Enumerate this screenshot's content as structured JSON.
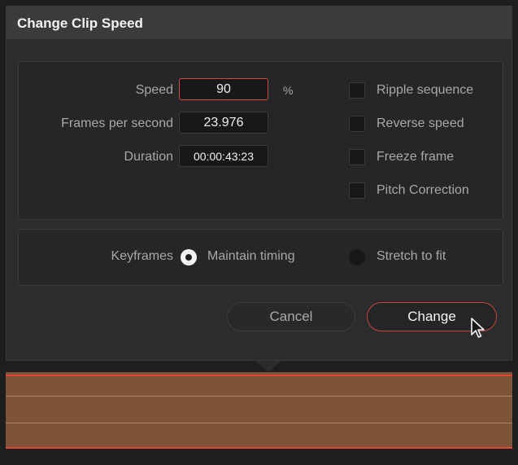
{
  "dialog": {
    "title": "Change Clip Speed",
    "speed": {
      "label": "Speed",
      "value": "90",
      "unit": "%"
    },
    "fps": {
      "label": "Frames per second",
      "value": "23.976"
    },
    "duration": {
      "label": "Duration",
      "value": "00:00:43:23"
    },
    "options": [
      {
        "label": "Ripple sequence",
        "checked": false
      },
      {
        "label": "Reverse speed",
        "checked": false
      },
      {
        "label": "Freeze frame",
        "checked": false
      },
      {
        "label": "Pitch Correction",
        "checked": false
      }
    ],
    "keyframes": {
      "label": "Keyframes",
      "choices": [
        {
          "label": "Maintain timing",
          "selected": true
        },
        {
          "label": "Stretch to fit",
          "selected": false
        }
      ]
    },
    "buttons": {
      "cancel": "Cancel",
      "change": "Change"
    }
  },
  "colors": {
    "accent_red": "#d24a3a",
    "dialog_bg": "#2b2c2e",
    "clip_brown": "#7e5439"
  }
}
